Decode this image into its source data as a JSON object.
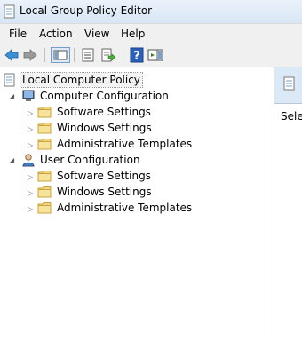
{
  "window": {
    "title": "Local Group Policy Editor"
  },
  "menu": [
    "File",
    "Action",
    "View",
    "Help"
  ],
  "toolbar": {
    "icons": [
      "back-arrow-icon",
      "forward-arrow-icon",
      "show-hide-console-tree-icon",
      "properties-icon",
      "export-list-icon",
      "help-icon",
      "show-hide-action-pane-icon"
    ]
  },
  "tree": {
    "root": {
      "label": "Local Computer Policy"
    },
    "computer": {
      "label": "Computer Configuration",
      "children": [
        "Software Settings",
        "Windows Settings",
        "Administrative Templates"
      ]
    },
    "user": {
      "label": "User Configuration",
      "children": [
        "Software Settings",
        "Windows Settings",
        "Administrative Templates"
      ]
    }
  },
  "right_pane": {
    "text": "Selec"
  }
}
